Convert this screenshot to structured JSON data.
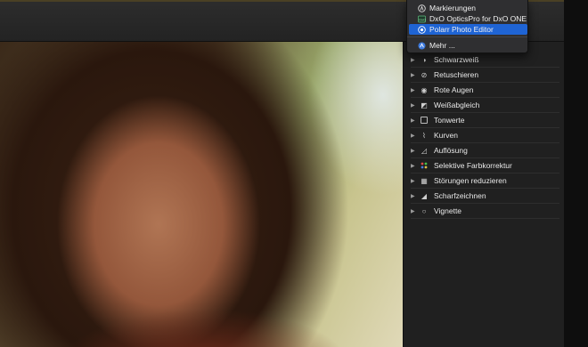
{
  "extensions_menu": {
    "items": [
      {
        "label": "Markierungen",
        "icon": "markup-icon",
        "selected": false
      },
      {
        "label": "DxO OpticsPro for DxO ONE",
        "icon": "dxo-icon",
        "selected": false
      },
      {
        "label": "Polarr Photo Editor",
        "icon": "polarr-icon",
        "selected": true
      }
    ],
    "more_label": "Mehr ...",
    "selected_color": "#1f64d4"
  },
  "adjustments": {
    "items": [
      {
        "label": "Schwarzweiß",
        "icon": "black-white-icon"
      },
      {
        "label": "Retuschieren",
        "icon": "bandage-icon"
      },
      {
        "label": "Rote Augen",
        "icon": "eye-icon"
      },
      {
        "label": "Weißabgleich",
        "icon": "white-balance-icon"
      },
      {
        "label": "Tonwerte",
        "icon": "levels-icon"
      },
      {
        "label": "Kurven",
        "icon": "curves-icon"
      },
      {
        "label": "Auflösung",
        "icon": "definition-icon"
      },
      {
        "label": "Selektive Farbkorrektur",
        "icon": "selective-color-icon"
      },
      {
        "label": "Störungen reduzieren",
        "icon": "noise-reduction-icon"
      },
      {
        "label": "Scharfzeichnen",
        "icon": "sharpen-icon"
      },
      {
        "label": "Vignette",
        "icon": "vignette-icon"
      }
    ]
  }
}
